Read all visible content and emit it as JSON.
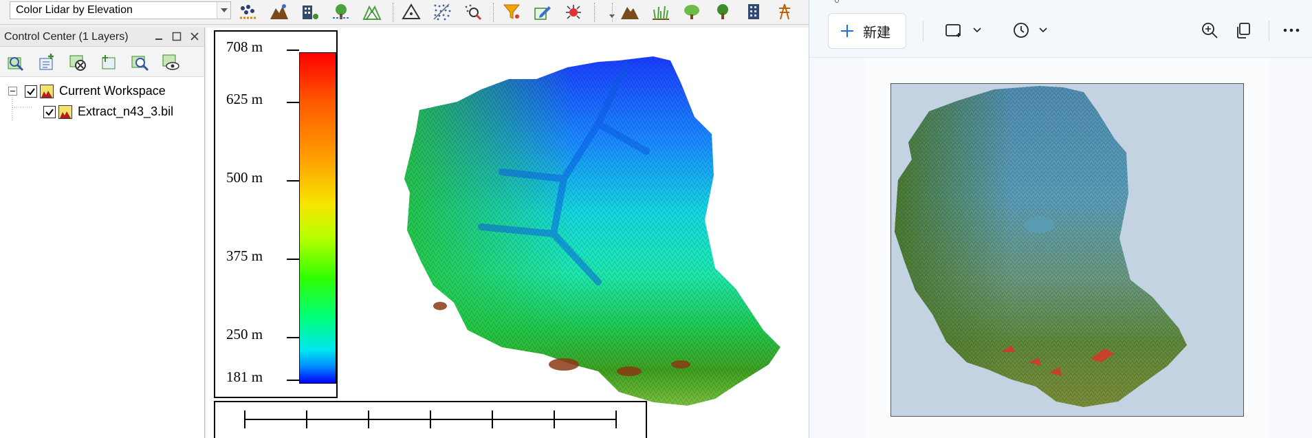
{
  "gis_app": {
    "toolbar": {
      "style_selector_value": "Color Lidar by Elevation",
      "icons": [
        "lidar-points-icon",
        "terrain-icon",
        "building-grid-icon",
        "tree-cell-icon",
        "mountain-triangle-icon",
        "triangle-icon",
        "point-cloud-icon",
        "point-search-icon",
        "filter-icon",
        "edit-points-icon",
        "bug-points-icon",
        "mountain-icon",
        "grass-icon",
        "tree-round-icon",
        "tree-icon",
        "building-icon",
        "power-line-icon"
      ]
    },
    "control_center": {
      "title": "Control Center (1 Layers)",
      "tools": [
        "zoom-to-layer-icon",
        "add-layer-icon",
        "remove-layer-icon",
        "layer-properties-icon",
        "find-layer-icon",
        "view-layer-icon"
      ],
      "tree": [
        {
          "label": "Current Workspace",
          "checked": true,
          "level": 0
        },
        {
          "label": "Extract_n43_3.bil",
          "checked": true,
          "level": 1
        }
      ]
    },
    "legend": {
      "labels": [
        "708 m",
        "625 m",
        "500 m",
        "375 m",
        "250 m",
        "181 m"
      ],
      "colors": [
        "#ff0000",
        "#ff9f00",
        "#f6e600",
        "#32ff00",
        "#00e7f0",
        "#0000ff"
      ]
    },
    "scale_bar": {
      "ticks": 7
    }
  },
  "photo_viewer": {
    "new_button_label": "新建",
    "icons": [
      "plus-icon",
      "crop-icon",
      "chevron-down-icon",
      "history-icon",
      "chevron-down-icon",
      "zoom-in-icon",
      "copy-icon",
      "more-icon"
    ]
  }
}
